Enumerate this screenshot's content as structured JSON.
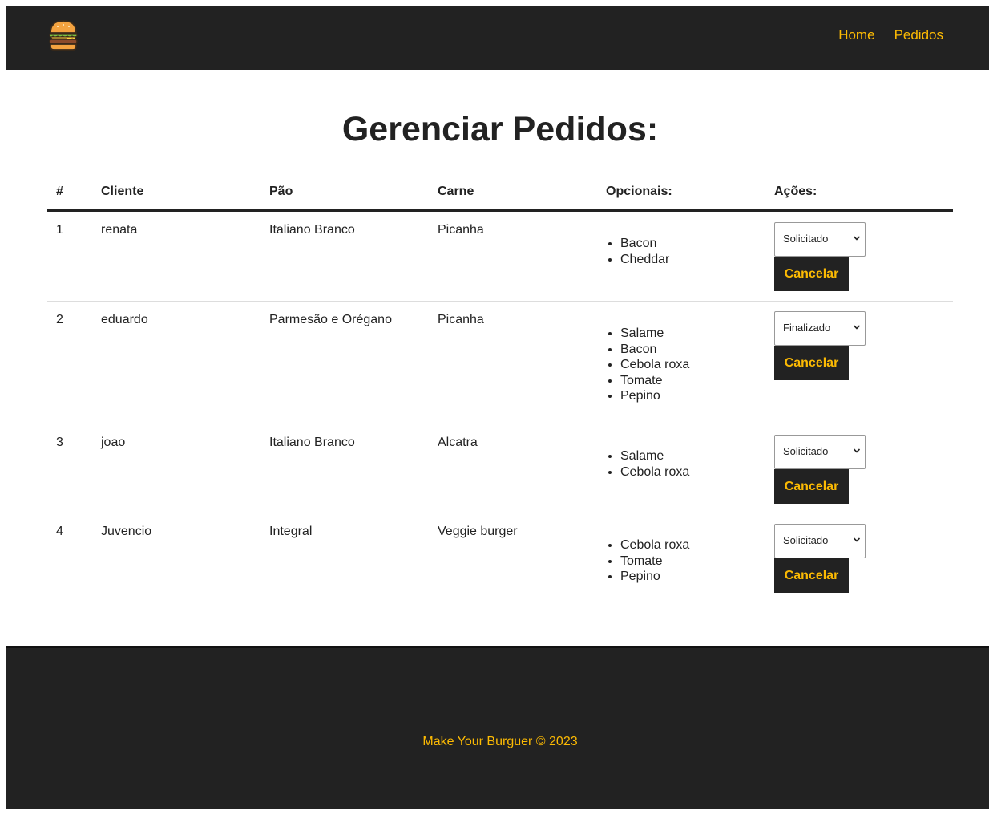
{
  "nav": {
    "logo_icon": "burger-icon",
    "links": [
      "Home",
      "Pedidos"
    ]
  },
  "page": {
    "title": "Gerenciar Pedidos:"
  },
  "table": {
    "headers": [
      "#",
      "Cliente",
      "Pão",
      "Carne",
      "Opcionais:",
      "Ações:"
    ],
    "rows": [
      {
        "id": "1",
        "cliente": "renata",
        "pao": "Italiano Branco",
        "carne": "Picanha",
        "opcionais": [
          "Bacon",
          "Cheddar"
        ],
        "status": "Solicitado",
        "action": "Cancelar"
      },
      {
        "id": "2",
        "cliente": "eduardo",
        "pao": "Parmesão e Orégano",
        "carne": "Picanha",
        "opcionais": [
          "Salame",
          "Bacon",
          "Cebola roxa",
          "Tomate",
          "Pepino"
        ],
        "status": "Finalizado",
        "action": "Cancelar"
      },
      {
        "id": "3",
        "cliente": "joao",
        "pao": "Italiano Branco",
        "carne": "Alcatra",
        "opcionais": [
          "Salame",
          "Cebola roxa"
        ],
        "status": "Solicitado",
        "action": "Cancelar"
      },
      {
        "id": "4",
        "cliente": "Juvencio",
        "pao": "Integral",
        "carne": "Veggie burger",
        "opcionais": [
          "Cebola roxa",
          "Tomate",
          "Pepino"
        ],
        "status": "Solicitado",
        "action": "Cancelar"
      }
    ]
  },
  "footer": {
    "text": "Make Your Burguer © 2023"
  },
  "colors": {
    "accent": "#fcba03",
    "dark": "#222222"
  }
}
